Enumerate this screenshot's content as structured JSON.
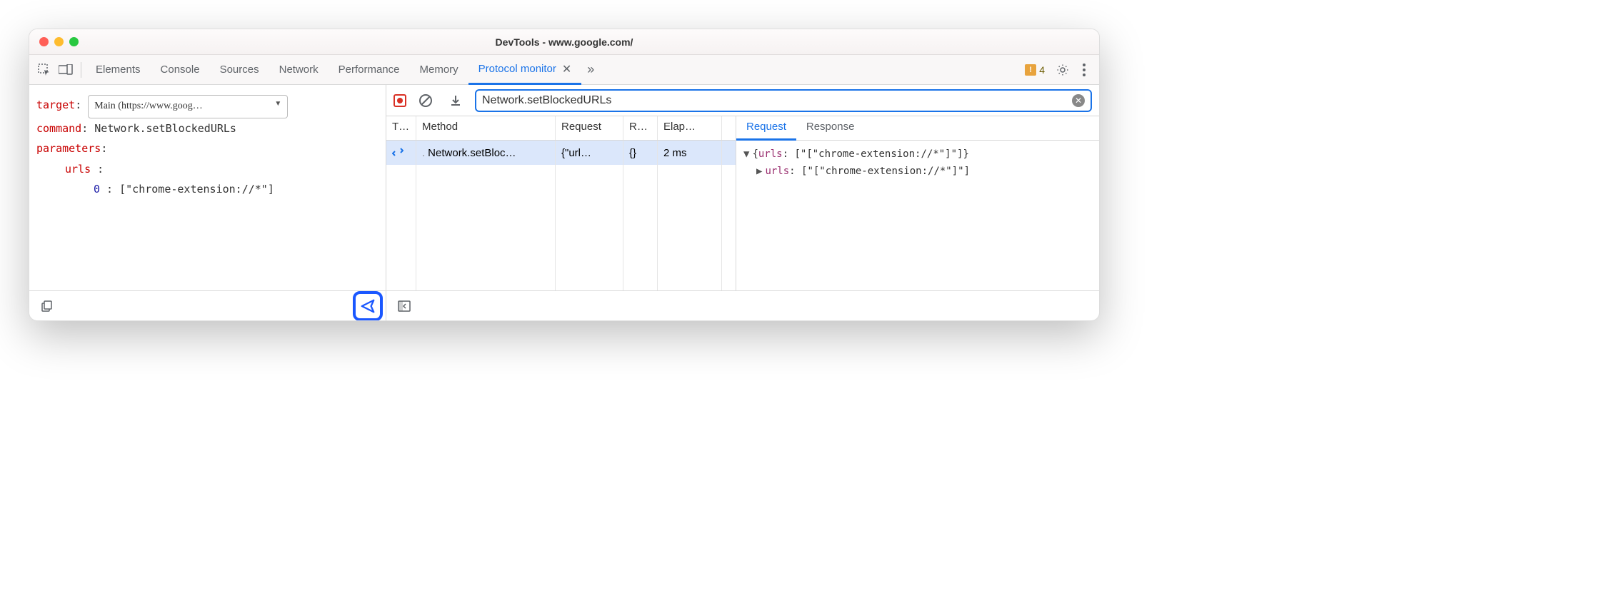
{
  "window": {
    "title": "DevTools - www.google.com/"
  },
  "tabs": {
    "items": [
      "Elements",
      "Console",
      "Sources",
      "Network",
      "Performance",
      "Memory",
      "Protocol monitor"
    ],
    "active": "Protocol monitor"
  },
  "warnings": {
    "count": "4"
  },
  "editor": {
    "target_label": "target",
    "target_value": "Main (https://www.goog…",
    "command_label": "command",
    "command_value": "Network.setBlockedURLs",
    "parameters_label": "parameters",
    "param_key": "urls",
    "param_index": "0",
    "param_value": "[\"chrome-extension://*\"]"
  },
  "filter": {
    "value": "Network.setBlockedURLs"
  },
  "grid": {
    "headers": {
      "type": "T…",
      "method": "Method",
      "request": "Request",
      "response": "R…",
      "elapsed": "Elap…"
    },
    "row": {
      "method": "Network.setBloc…",
      "request": "{\"url…",
      "response": "{}",
      "elapsed": "2 ms"
    }
  },
  "detail": {
    "tabs": {
      "request": "Request",
      "response": "Response"
    },
    "active": "Request",
    "line1_prop": "urls",
    "line1_rest": " [\"[\"chrome-extension://*\"]\"]}",
    "line2_prop": "urls",
    "line2_rest": " [\"[\"chrome-extension://*\"]\"]"
  }
}
